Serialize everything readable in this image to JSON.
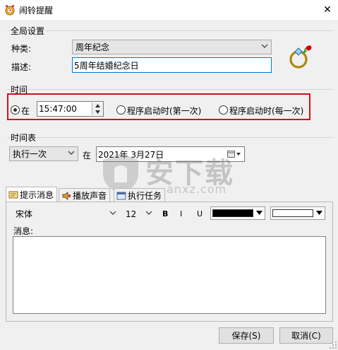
{
  "window": {
    "title": "闹铃提醒",
    "close_glyph": "✕"
  },
  "global_settings": {
    "group_label": "全局设置",
    "kind_label": "种类:",
    "kind_value": "周年纪念",
    "description_label": "描述:",
    "description_value": "5周年结婚纪念日"
  },
  "time": {
    "group_label": "时间",
    "at_label": "在",
    "time_value": "15:47:00",
    "option_first_start_label": "程序启动时(第一次)",
    "option_every_start_label": "程序启动时(每一次)",
    "selected_option": "at"
  },
  "schedule": {
    "group_label": "时间表",
    "frequency_value": "执行一次",
    "at_label": "在",
    "date_value": "2021年 3月27日"
  },
  "tabs": [
    {
      "label": "提示消息",
      "icon": "message-icon",
      "active": true
    },
    {
      "label": "播放声音",
      "icon": "speaker-icon",
      "active": false
    },
    {
      "label": "执行任务",
      "icon": "task-icon",
      "active": false
    }
  ],
  "message": {
    "font_value": "宋体",
    "size_value": "12",
    "bold_label": "B",
    "italic_label": "I",
    "underline_label": "U",
    "text_color": "#000000",
    "background_color": "#ffffff",
    "message_label": "消息:",
    "message_value": ""
  },
  "buttons": {
    "save_label": "保存(S)",
    "cancel_label": "取消(C)"
  },
  "watermark": {
    "text_large": "安下载",
    "text_small": "anxz.com"
  },
  "colors": {
    "highlight_border": "#d0121b",
    "focus_border": "#0078d7"
  }
}
